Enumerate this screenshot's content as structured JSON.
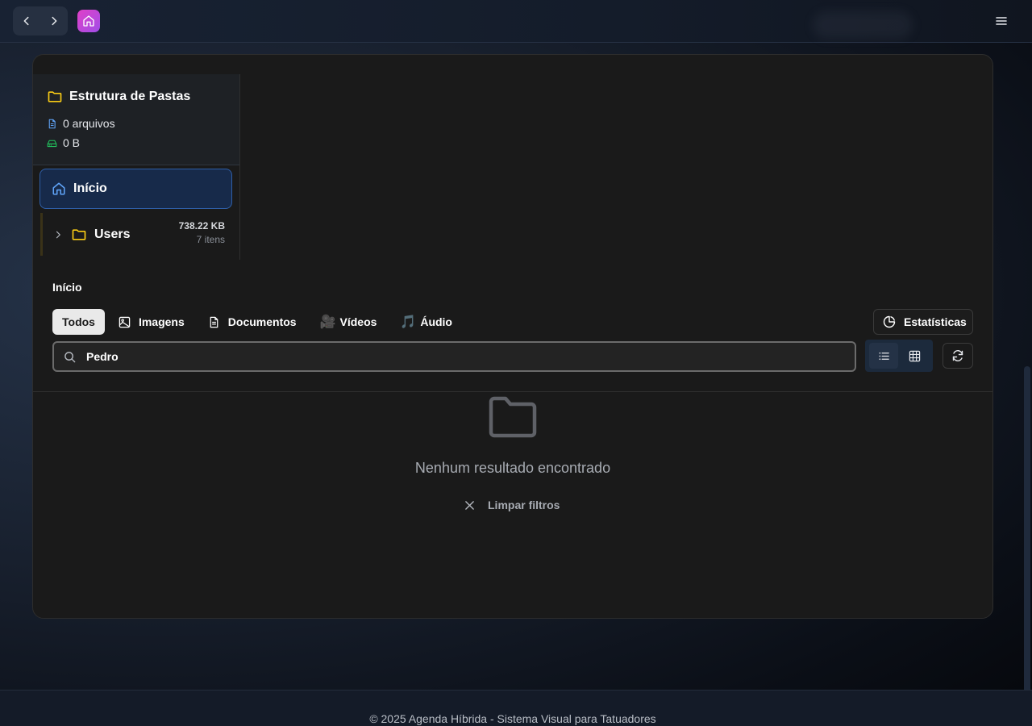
{
  "topbar": {
    "back_icon": "chevron-left-icon",
    "forward_icon": "chevron-right-icon",
    "logo_icon": "home-icon",
    "menu_icon": "hamburger-menu-icon"
  },
  "sidebar": {
    "title": "Estrutura de Pastas",
    "files_count": "0 arquivos",
    "total_size": "0 B",
    "home_label": "Início",
    "folders": [
      {
        "name": "Users",
        "size": "738.22 KB",
        "items": "7 itens"
      }
    ]
  },
  "breadcrumb": "Início",
  "tabs": [
    {
      "label": "Todos",
      "icon": "",
      "active": true
    },
    {
      "label": "Imagens",
      "icon": "image-icon"
    },
    {
      "label": "Documentos",
      "icon": "document-icon"
    },
    {
      "label": "Vídeos",
      "icon": "🎥"
    },
    {
      "label": "Áudio",
      "icon": "🎵"
    }
  ],
  "stats_button": "Estatísticas",
  "search": {
    "value": "Pedro",
    "placeholder": ""
  },
  "view_mode": "list",
  "empty_state": {
    "message": "Nenhum resultado encontrado",
    "clear_label": "Limpar filtros"
  },
  "footer": "© 2025 Agenda Híbrida - Sistema Visual para Tatuadores",
  "colors": {
    "accent_blue": "#3b82f6",
    "folder_yellow": "#facc15",
    "drive_green": "#22c55e",
    "logo_gradient": [
      "#e040c8",
      "#a04ee8"
    ]
  }
}
